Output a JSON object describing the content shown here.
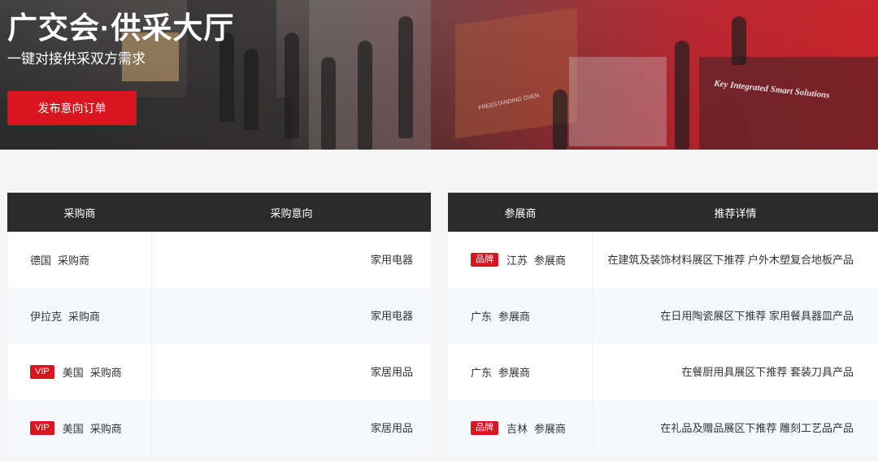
{
  "hero": {
    "title": "广交会·供采大厅",
    "subtitle": "一键对接供采双方需求",
    "button_label": "发布意向订单",
    "booth_sign": "Key Integrated Smart Solutions",
    "booth_sign2": "FREESTANDING OVEN"
  },
  "buyers": {
    "headers": [
      "采购商",
      "采购意向"
    ],
    "rows": [
      {
        "badge": "",
        "country": "德国",
        "role": "采购商",
        "intent": "家用电器"
      },
      {
        "badge": "",
        "country": "伊拉克",
        "role": "采购商",
        "intent": "家用电器"
      },
      {
        "badge": "VIP",
        "country": "美国",
        "role": "采购商",
        "intent": "家居用品"
      },
      {
        "badge": "VIP",
        "country": "美国",
        "role": "采购商",
        "intent": "家居用品"
      }
    ]
  },
  "exhibitors": {
    "headers": [
      "参展商",
      "推荐详情"
    ],
    "rows": [
      {
        "badge": "品牌",
        "province": "江苏",
        "role": "参展商",
        "detail": "在建筑及装饰材料展区下推荐 户外木塑复合地板产品"
      },
      {
        "badge": "",
        "province": "广东",
        "role": "参展商",
        "detail": "在日用陶瓷展区下推荐 家用餐具器皿产品"
      },
      {
        "badge": "",
        "province": "广东",
        "role": "参展商",
        "detail": "在餐厨用具展区下推荐 套装刀具产品"
      },
      {
        "badge": "品牌",
        "province": "吉林",
        "role": "参展商",
        "detail": "在礼品及赠品展区下推荐 雕刻工艺品产品"
      }
    ]
  },
  "colors": {
    "accent": "#d9161f",
    "header_bg": "#2b2b2b"
  }
}
